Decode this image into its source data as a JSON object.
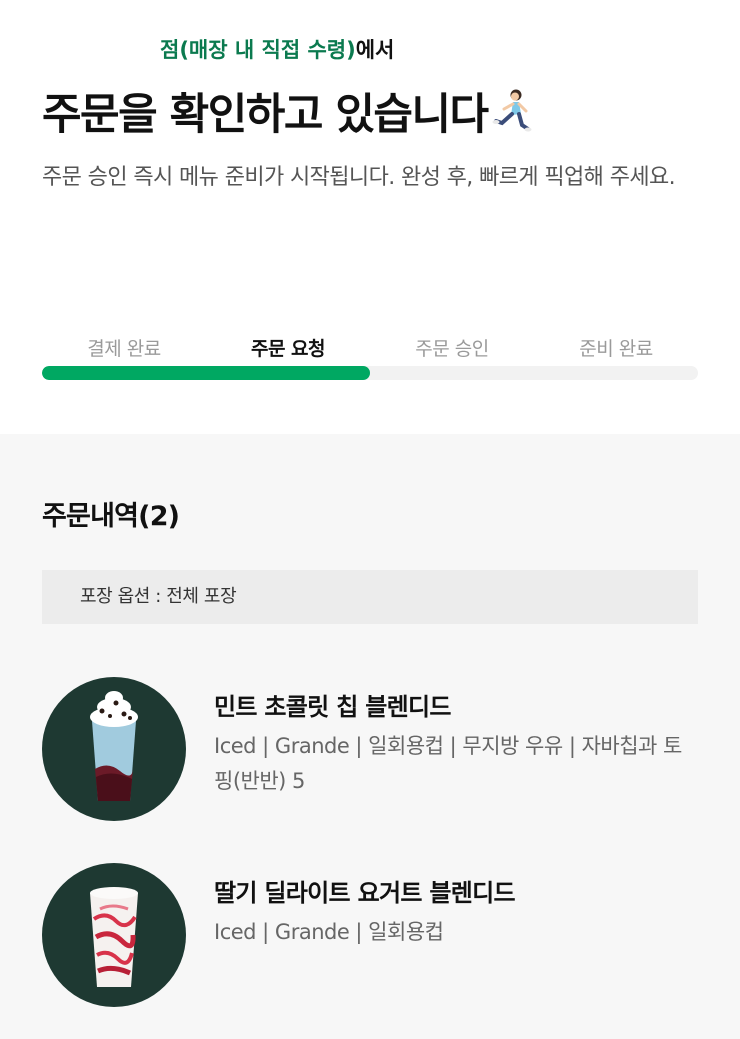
{
  "header": {
    "store_name": "점(매장 내 직접 수령)",
    "store_suffix": "에서",
    "headline": "주문을 확인하고 있습니다",
    "headline_icon": "running-person-icon",
    "description": "주문 승인 즉시 메뉴 준비가 시작됩니다. 완성 후, 빠르게 픽업해 주세요."
  },
  "progress": {
    "steps": [
      "결제 완료",
      "주문 요청",
      "주문 승인",
      "준비 완료"
    ],
    "active_index": 1,
    "fraction": 0.5,
    "accent_color": "#00a862"
  },
  "order": {
    "title": "주문내역(2)",
    "packaging": "포장 옵션 : 전체 포장",
    "items": [
      {
        "name": "민트 초콜릿 칩 블렌디드",
        "options": "Iced | Grande | 일회용컵 | 무지방 우유 | 자바칩과 토핑(반반) 5",
        "image": "mint-chocolate-chip-blended-image"
      },
      {
        "name": "딸기 딜라이트 요거트 블렌디드",
        "options": "Iced | Grande | 일회용컵",
        "image": "strawberry-delight-yogurt-blended-image"
      }
    ]
  },
  "colors": {
    "brand_green": "#0b7a4f",
    "thumb_bg": "#1e3932"
  }
}
